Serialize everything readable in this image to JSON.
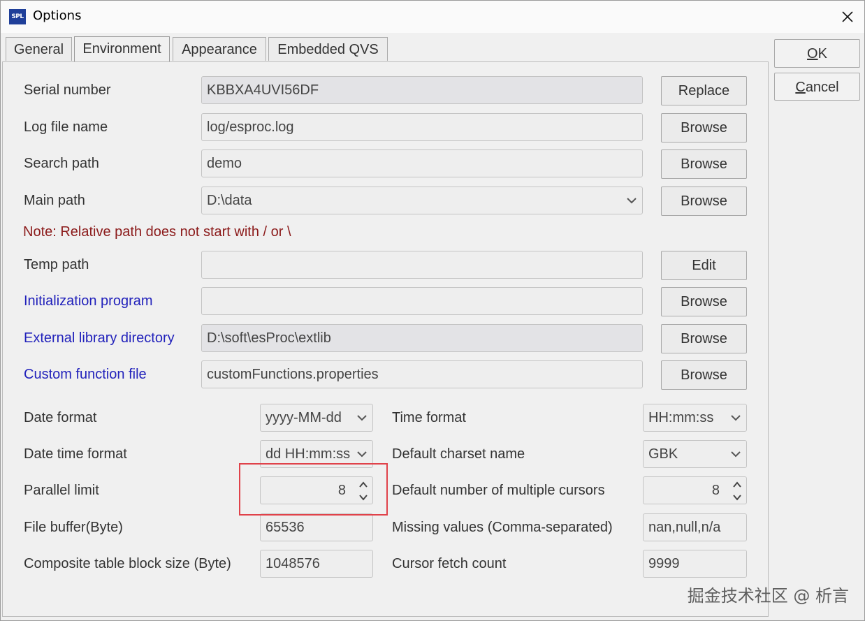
{
  "window": {
    "title": "Options",
    "app_icon_text": "SPL"
  },
  "tabs": [
    {
      "label": "General",
      "active": false
    },
    {
      "label": "Environment",
      "active": true
    },
    {
      "label": "Appearance",
      "active": false
    },
    {
      "label": "Embedded QVS",
      "active": false
    }
  ],
  "buttons": {
    "ok": "OK",
    "ok_mnemonic": "O",
    "ok_rest": "K",
    "cancel_mnemonic": "C",
    "cancel_rest": "ancel"
  },
  "paths": [
    {
      "label": "Serial number",
      "value": "KBBXA4UVI56DF",
      "button": "Replace"
    },
    {
      "label": "Log file name",
      "value": "log/esproc.log",
      "button": "Browse"
    },
    {
      "label": "Search path",
      "value": "demo",
      "button": "Browse"
    },
    {
      "label": "Main path",
      "value": "D:\\data",
      "button": "Browse"
    },
    {
      "label": "Temp path",
      "value": "",
      "button": "Edit"
    },
    {
      "label": "Initialization program",
      "value": "",
      "button": "Browse"
    },
    {
      "label": "External library directory",
      "value": "D:\\soft\\esProc\\extlib",
      "button": "Browse"
    },
    {
      "label": "Custom function file",
      "value": "customFunctions.properties",
      "button": "Browse"
    }
  ],
  "note": "Note: Relative path does not start with / or \\",
  "settings": {
    "date_format": {
      "label": "Date format",
      "value": "yyyy-MM-dd"
    },
    "time_format": {
      "label": "Time format",
      "value": "HH:mm:ss"
    },
    "date_time_format": {
      "label": "Date time format",
      "value": "dd HH:mm:ss"
    },
    "default_charset": {
      "label": "Default charset name",
      "value": "GBK"
    },
    "parallel_limit": {
      "label": "Parallel limit",
      "value": "8"
    },
    "multiple_cursors": {
      "label": "Default number of multiple cursors",
      "value": "8"
    },
    "file_buffer": {
      "label": "File buffer(Byte)",
      "value": "65536"
    },
    "missing_values": {
      "label": "Missing values (Comma-separated)",
      "value": "nan,null,n/a"
    },
    "block_size": {
      "label": "Composite table block size (Byte)",
      "value": "1048576"
    },
    "cursor_fetch": {
      "label": "Cursor fetch count",
      "value": "9999"
    }
  },
  "watermark": "掘金技术社区 @ 析言",
  "colors": {
    "link_label": "#2222bb",
    "note": "#8b1a1a",
    "highlight": "#e0424a"
  }
}
